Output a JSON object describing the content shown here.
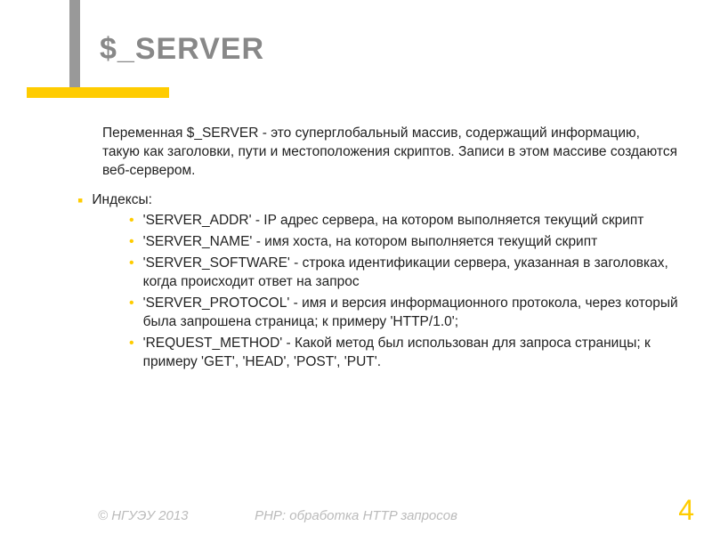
{
  "title": "$_SERVER",
  "intro": "Переменная $_SERVER - это суперглобальный массив, содержащий информацию, такую как заголовки, пути и местоположения скриптов. Записи в этом массиве создаются веб-сервером.",
  "index_label": "Индексы:",
  "items": [
    "'SERVER_ADDR'  - IP адрес сервера, на котором выполняется текущий скрипт",
    "'SERVER_NAME' - имя хоста, на котором выполняется текущий скрипт",
    "'SERVER_SOFTWARE' - строка идентификации сервера, указанная в заголовках, когда происходит ответ на запрос",
    "'SERVER_PROTOCOL' - имя и версия информационного протокола, через который была запрошена страница; к примеру 'HTTP/1.0';",
    "'REQUEST_METHOD' - Какой метод был использован для запроса страницы; к примеру 'GET', 'HEAD', 'POST', 'PUT'."
  ],
  "footer": {
    "copyright": "© НГУЭУ 2013",
    "subject": "PHP: обработка HTTP запросов",
    "page": "4"
  }
}
